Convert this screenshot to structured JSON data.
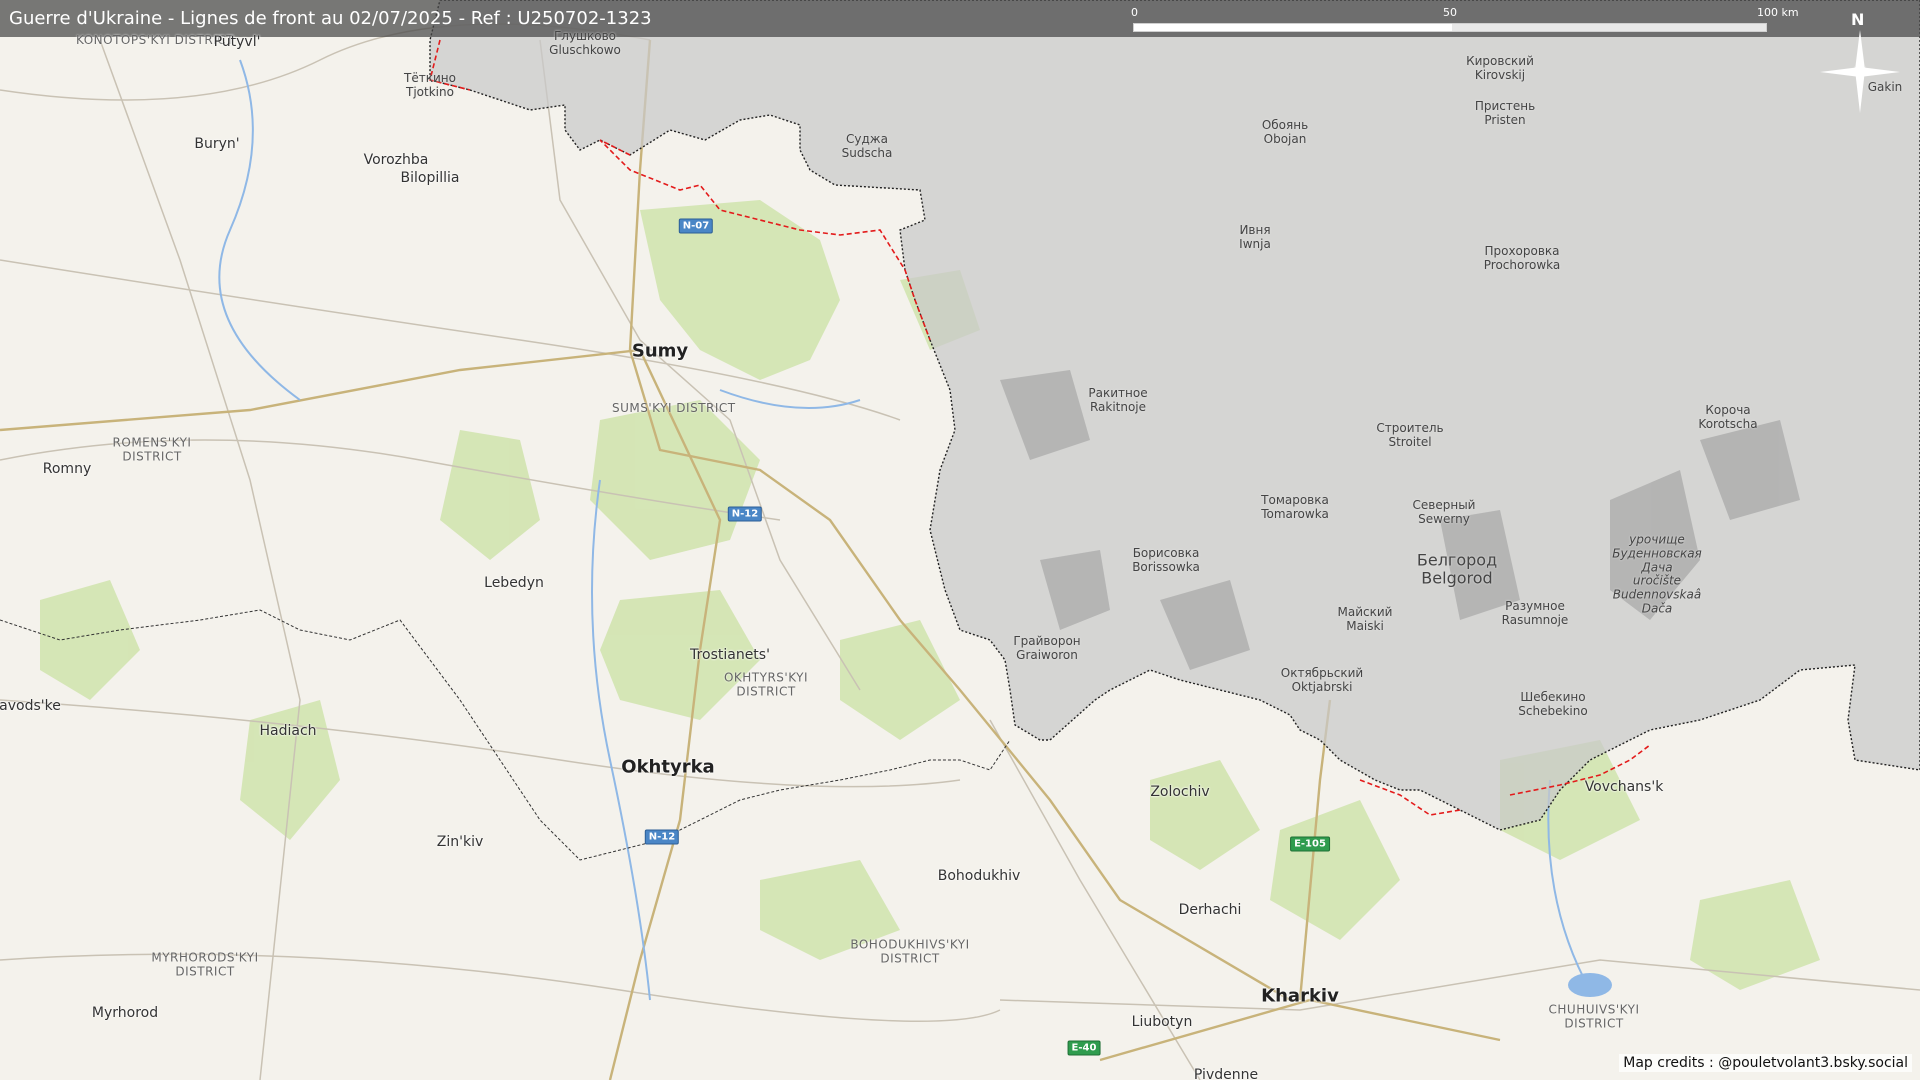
{
  "header": {
    "title": "Guerre d'Ukraine - Lignes de front au 02/07/2025 - Ref : U250702-1323"
  },
  "scale": {
    "ticks": [
      "0",
      "50",
      "100 km"
    ]
  },
  "north_label": "N",
  "credits": "Map credits : @pouletvolant3.bsky.social",
  "colors": {
    "russia_overlay": "#c7c7c7",
    "front_line": "#e31b1b",
    "border": "#222222",
    "forest": "#cfe1ab",
    "water": "#8fb8e6",
    "background": "#f4f2ec"
  },
  "places": {
    "konotop_district": "KONOTOPS'KYI DISTRICT",
    "putyvl": "Putyvl'",
    "buryn": "Buryn'",
    "vorozhba": "Vorozhba",
    "bilopillia": "Bilopillia",
    "sumy": "Sumy",
    "sumy_district": "SUMS'KYI DISTRICT",
    "romny": "Romny",
    "romny_district": "ROMENS'KYI DISTRICT",
    "lebedyn": "Lebedyn",
    "trostianets": "Trostianets'",
    "okhtyrka_district": "OKHTYRS'KYI DISTRICT",
    "okhtyrka": "Okhtyrka",
    "hadiach": "Hadiach",
    "zavodske": "avods'ke",
    "zinkiv": "Zin'kiv",
    "myrhorod_district": "MYRHORODS'KYI DISTRICT",
    "myrhorod": "Myrhorod",
    "bohodukhiv": "Bohodukhiv",
    "bohodukhiv_district": "BOHODUKHIVS'KYI DISTRICT",
    "zolochiv": "Zolochiv",
    "derhachi": "Derhachi",
    "kharkiv": "Kharkiv",
    "liubotyn": "Liubotyn",
    "pivdenne": "Pivdenne",
    "vovchansk": "Vovchans'k",
    "chuhuiv_district": "CHUHUIVS'KYI DISTRICT",
    "tiotkino": "Тёткино\nTjotkino",
    "glushkovo": "Глушково\nGluschkowo",
    "sudzha": "Суджа\nSudscha",
    "kirovskij": "Кировский\nKirovskij",
    "pristen": "Пристень\nPristen",
    "oboyan": "Обоянь\nObojan",
    "ivnya": "Ивня\nIwnja",
    "prokhorovka": "Прохоровка\nProchorowka",
    "rakitnoe": "Ракитное\nRakitnoje",
    "stroitel": "Строитель\nStroitel",
    "korocha": "Короча\nKorotscha",
    "tomarovka": "Томаровка\nTomarowka",
    "severny": "Северный\nSewerny",
    "borisovka": "Борисовка\nBorissowka",
    "belgorod": "Белгород\nBelgorod",
    "maiski": "Майский\nMaiski",
    "razumnoe": "Разумное\nRasumnoje",
    "graivoron": "Грайворон\nGraiworon",
    "oktyabrski": "Октябрьский\nOktjabrski",
    "shebekino": "Шебекино\nSchebekino",
    "budennovskaya": "урочище\nБуденновская\nДача\nuročište\nBudennovskaâ\nDača",
    "gakin": "Gakin"
  },
  "roads": {
    "n07": "N-07",
    "n12a": "N-12",
    "n12b": "N-12",
    "e105": "E-105",
    "e40": "E-40"
  }
}
